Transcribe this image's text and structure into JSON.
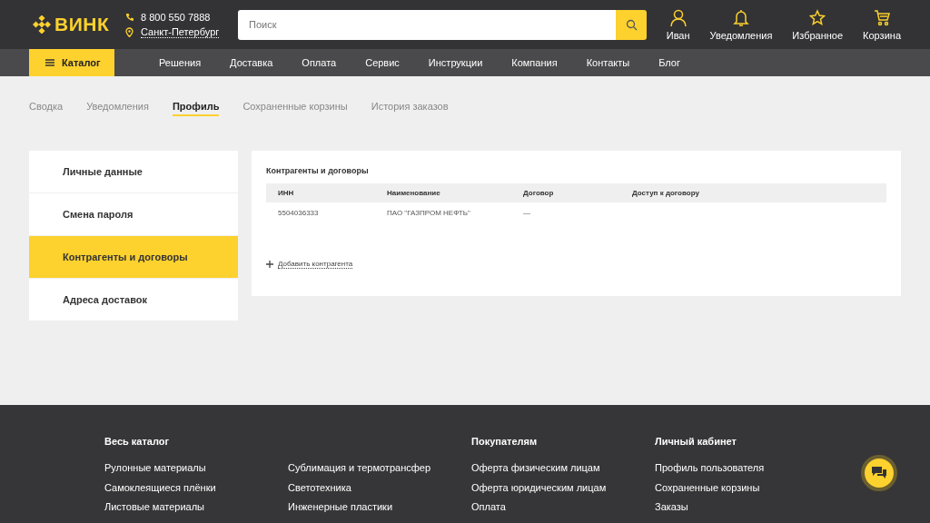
{
  "header": {
    "logo": "ВИНК",
    "phone": "8 800 550 7888",
    "city": "Санкт-Петербург",
    "search": {
      "placeholder": "Поиск"
    },
    "actions": [
      {
        "kind": "user",
        "label": "Иван"
      },
      {
        "kind": "bell",
        "label": "Уведомления"
      },
      {
        "kind": "star",
        "label": "Избранное"
      },
      {
        "kind": "cart",
        "label": "Корзина"
      }
    ]
  },
  "nav": {
    "catalog": "Каталог",
    "items": [
      "Решения",
      "Доставка",
      "Оплата",
      "Сервис",
      "Инструкции",
      "Компания",
      "Контакты",
      "Блог"
    ]
  },
  "tabs": [
    {
      "label": "Сводка",
      "selected": false
    },
    {
      "label": "Уведомления",
      "selected": false
    },
    {
      "label": "Профиль",
      "selected": true
    },
    {
      "label": "Сохраненные корзины",
      "selected": false
    },
    {
      "label": "История заказов",
      "selected": false
    }
  ],
  "sidebar": {
    "items": [
      {
        "label": "Личные данные",
        "selected": false
      },
      {
        "label": "Смена пароля",
        "selected": false
      },
      {
        "label": "Контрагенты и договоры",
        "selected": true
      },
      {
        "label": "Адреса доставок",
        "selected": false
      }
    ]
  },
  "panel": {
    "title": "Контрагенты и договоры",
    "table": {
      "columns": [
        "ИНН",
        "Наименование",
        "Договор",
        "Доступ к договору"
      ],
      "rows": [
        [
          "5504036333",
          "ПАО \"ГАЗПРОМ НЕФТЬ\"",
          "—"
        ]
      ]
    },
    "add_link": "Добавить контрагента"
  },
  "footer": {
    "columns": [
      {
        "title": "Весь каталог",
        "links": [
          "Рулонные материалы",
          "Самоклеящиеся плёнки",
          "Листовые материалы"
        ]
      },
      {
        "links": [
          "Сублимация и термотрансфер",
          "Светотехника",
          "Инженерные пластики"
        ]
      },
      {
        "title": "Покупателям",
        "links": [
          "Оферта физическим лицам",
          "Оферта юридическим лицам",
          "Оплата"
        ]
      },
      {
        "title": "Личный кабинет",
        "links": [
          "Профиль пользователя",
          "Сохраненные корзины",
          "Заказы"
        ]
      }
    ]
  }
}
